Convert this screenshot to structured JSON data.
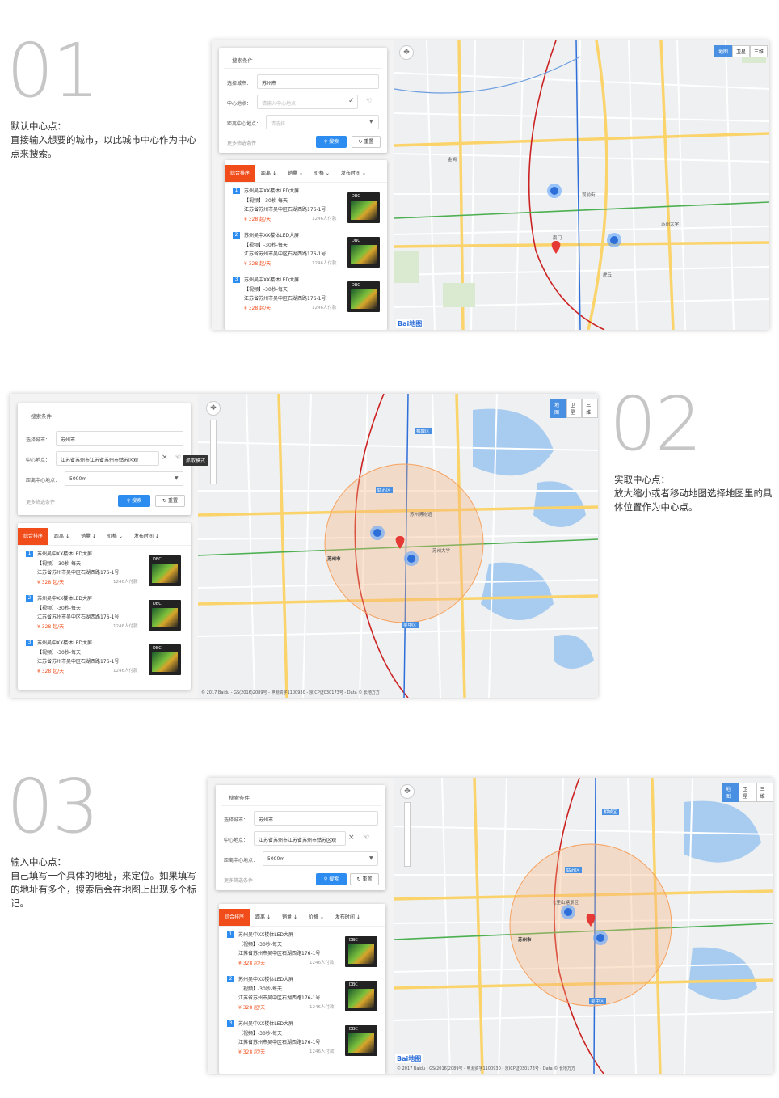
{
  "sections": [
    {
      "number": "01",
      "heading": "默认中心点：",
      "description": "直接输入想要的城市，以此城市中心作为中心点来搜索。"
    },
    {
      "number": "02",
      "heading": "实取中心点：",
      "description": "放大缩小或者移动地图选择地图里的具体位置作为中心点。"
    },
    {
      "number": "03",
      "heading": "输入中心点：",
      "description": "自己填写一个具体的地址，来定位。如果填写的地址有多个，搜索后会在地图上出现多个标记。"
    }
  ],
  "search_panel": {
    "title": "搜索条件",
    "city_label": "选择城市：",
    "city_value": "苏州市",
    "center_label": "中心地点：",
    "center_placeholder": "请输入中心地点",
    "center_value": "江苏省苏州市江苏省苏州市姑苏区观",
    "distance_label": "距离中心地点：",
    "distance_placeholder": "请选择",
    "distance_value": "5000m",
    "more_filters": "更多筛选条件",
    "search_button": "搜索",
    "reset_button": "重置",
    "capture_tooltip": "抓取模式"
  },
  "sort_tabs": [
    "综合排序",
    "距离",
    "销量",
    "价格",
    "发布时间"
  ],
  "listing_items": [
    {
      "index": "1",
      "title": "苏州吴中XX楼体LED大屏",
      "spec": "【视频】-30秒-每天",
      "address": "江苏省苏州市吴中区石湖西路176-1号",
      "price": "¥ 328 起/天",
      "sales": "1246人付款"
    },
    {
      "index": "2",
      "title": "苏州吴中XX楼体LED大屏",
      "spec": "【视频】-30秒-每天",
      "address": "江苏省苏州市吴中区石湖西路176-1号",
      "price": "¥ 328 起/天",
      "sales": "1246人付款"
    },
    {
      "index": "3",
      "title": "苏州吴中XX楼体LED大屏",
      "spec": "【视频】-30秒-每天",
      "address": "江苏省苏州市吴中区石湖西路176-1号",
      "price": "¥ 328 起/天",
      "sales": "1246人付款"
    }
  ],
  "listing_image_label": "DBC",
  "map": {
    "types": [
      "地图",
      "卫星",
      "三维"
    ],
    "logo": "Bai地图",
    "copyright": "© 2017 Baidu - GS(2016)2089号 - 甲测资字1100930 - 京ICP证030173号 - Data © 长地万方",
    "district_labels": [
      "姑苏区",
      "相城区",
      "吴中区",
      "苏州市",
      "苏州大学",
      "苏州博物馆",
      "七里山塘景区",
      "观前街",
      "南门",
      "虎丘",
      "金阊",
      "寒山寺"
    ],
    "marker_counts": [
      "4",
      "3"
    ]
  },
  "colors": {
    "accent_orange": "#f04d1a",
    "accent_blue": "#2d8cf0",
    "number_gray": "#c6c6c6"
  }
}
